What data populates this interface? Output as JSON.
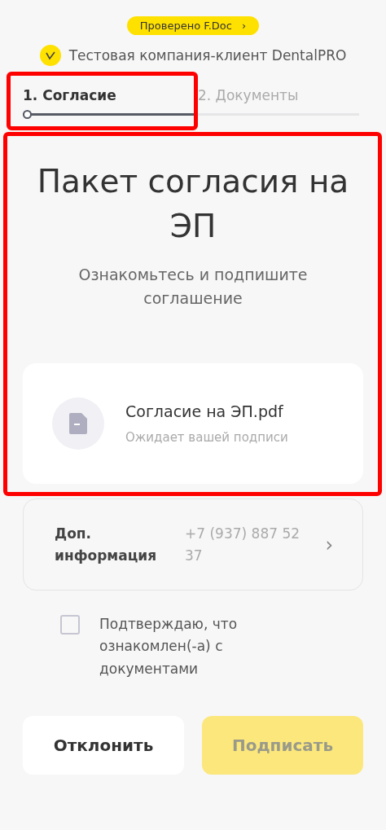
{
  "verified_badge": {
    "label": "Проверено F.Doc",
    "arrow": "›"
  },
  "company": {
    "name": "Тестовая компания-клиент DentalPRO"
  },
  "steps": [
    {
      "label": "1. Согласие",
      "selected": true,
      "highlighted": true
    },
    {
      "label": "2. Документы",
      "selected": false,
      "highlighted": false
    }
  ],
  "intro": {
    "title": "Пакет согласия на ЭП",
    "subtitle": "Ознакомьтесь и подпишите соглашение",
    "highlighted": true
  },
  "document": {
    "name": "Согласие на ЭП.pdf",
    "status": "Ожидает вашей подписи"
  },
  "info": {
    "label": "Доп. информация",
    "value": "+7 (937) 887 52 37",
    "arrow": "›"
  },
  "consent": {
    "label": "Подтверждаю, что ознакомлен(-а) с документами",
    "checked": false
  },
  "buttons": [
    {
      "label": "Отклонить",
      "kind": "secondary",
      "disabled": false
    },
    {
      "label": "Подписать",
      "kind": "primary",
      "disabled": true
    }
  ]
}
